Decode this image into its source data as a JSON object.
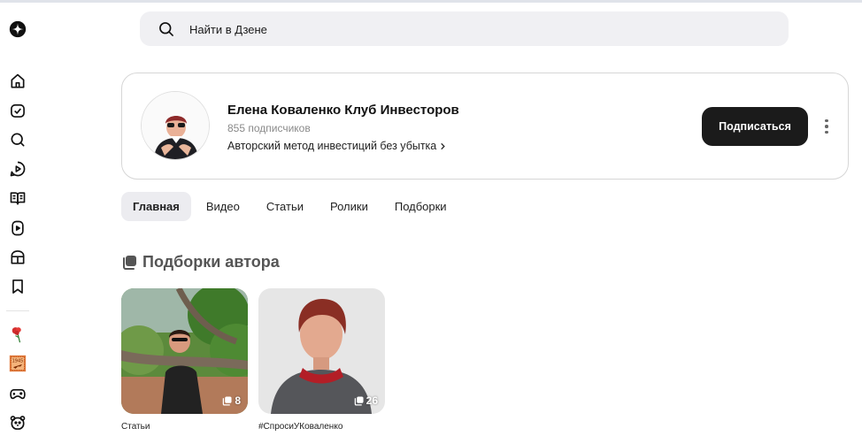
{
  "search": {
    "placeholder": "Найти в Дзене"
  },
  "sidebar": {
    "items": [
      {
        "icon": "zen-logo-icon"
      },
      {
        "icon": "home-icon"
      },
      {
        "icon": "calendar-check-icon"
      },
      {
        "icon": "search-icon"
      },
      {
        "icon": "play-circle-icon"
      },
      {
        "icon": "book-icon"
      },
      {
        "icon": "video-icon"
      },
      {
        "icon": "box-icon"
      },
      {
        "icon": "bookmark-icon"
      },
      {
        "icon": "carnation-icon"
      },
      {
        "icon": "stamp-1945-icon"
      },
      {
        "icon": "gamepad-icon"
      },
      {
        "icon": "bear-icon"
      }
    ]
  },
  "profile": {
    "name": "Елена Коваленко Клуб Инвесторов",
    "subscribers": "855 подписчиков",
    "description": "Авторский метод инвестиций без убытка",
    "subscribe_label": "Подписаться"
  },
  "tabs": [
    {
      "label": "Главная",
      "active": true
    },
    {
      "label": "Видео",
      "active": false
    },
    {
      "label": "Статьи",
      "active": false
    },
    {
      "label": "Ролики",
      "active": false
    },
    {
      "label": "Подборки",
      "active": false
    }
  ],
  "section": {
    "title": "Подборки автора"
  },
  "collections": [
    {
      "caption": "Статьи",
      "count": "8"
    },
    {
      "caption": "#СпросиУКоваленко",
      "count": "26"
    }
  ],
  "colors": {
    "accent": "#1b1b1b",
    "tab_active_bg": "#ececf0",
    "search_bg": "#f0f0f3"
  }
}
